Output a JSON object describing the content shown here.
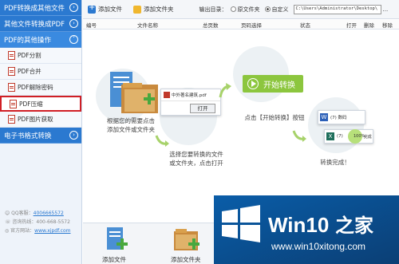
{
  "sidebar": {
    "categories": [
      {
        "label": "PDF转换成其他文件"
      },
      {
        "label": "其他文件转换成PDF"
      },
      {
        "label": "PDF的其他操作"
      },
      {
        "label": "电子书格式转换"
      }
    ],
    "items": [
      {
        "label": "PDF分割"
      },
      {
        "label": "PDF合并"
      },
      {
        "label": "PDF解除密码"
      },
      {
        "label": "PDF压缩"
      },
      {
        "label": "PDF图片获取"
      }
    ],
    "contact": {
      "qq_label": "QQ客服：",
      "qq_value": "4006665572",
      "phone": "咨询热线：400-668-5572",
      "site_label": "官方网站：",
      "site_value": "www.xjpdf.com"
    }
  },
  "toolbar": {
    "add_file": "添加文件",
    "add_folder": "添加文件夹",
    "output_label": "输出目录：",
    "radio_original": "原文件夹",
    "radio_custom": "自定义",
    "path": "C:\\Users\\Administrator\\Desktop\\",
    "browse": "..."
  },
  "table": {
    "columns": [
      "编号",
      "文件名称",
      "总页数",
      "页码选择",
      "状态",
      "打开",
      "删除",
      "移除"
    ]
  },
  "guide": {
    "step1": "根据您的需要点击\n添加文件或文件夹",
    "step2": "选择您要转换的文件\n或文件夹，点击打开",
    "step3": "点击【开始转换】按钮",
    "step4": "转换完成！",
    "start_button": "开始转换",
    "dialog_file": "中外著名建筑.pdf",
    "open_button": "打开",
    "result_line1": "(7) 数码",
    "result_line2": "(7)",
    "result_percent": "100%",
    "result_done": "完成"
  },
  "bottom": {
    "add_file": "添加文件",
    "add_folder": "添加文件夹"
  },
  "watermark": {
    "brand": "Win10",
    "brand_suffix": "之家",
    "url": "www.win10xitong.com"
  },
  "colors": {
    "sidebar_blue": "#2b79d0",
    "selected_border": "#d01f25",
    "green_button": "#8cc63e"
  }
}
